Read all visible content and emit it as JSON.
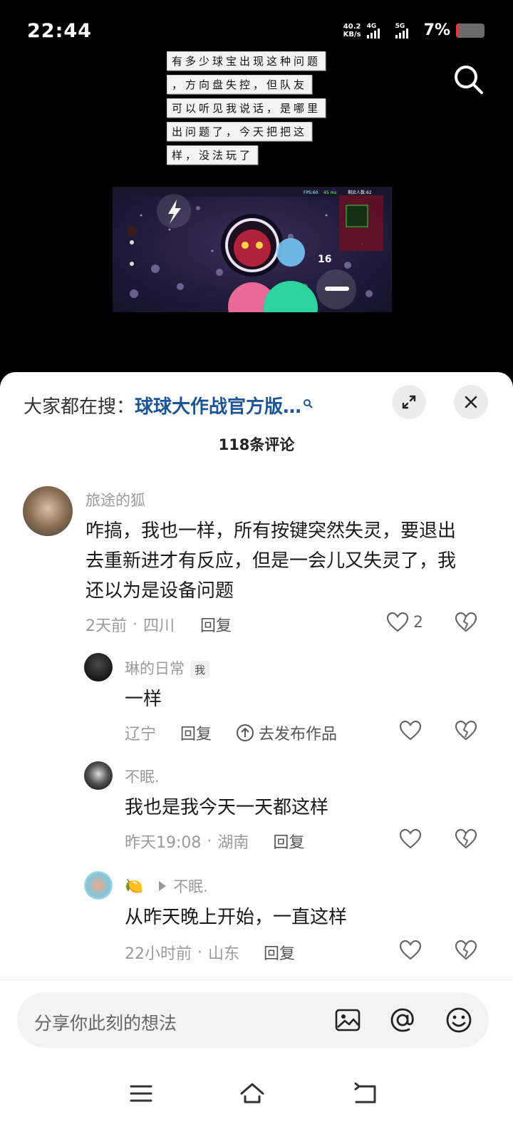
{
  "status_bar": {
    "time": "22:44",
    "net_speed_value": "40.2",
    "net_speed_unit": "KB/s",
    "sim1": "4G",
    "sim2": "5G",
    "battery": "7%"
  },
  "video": {
    "caption_lines": [
      "有多少球宝出现这种问题",
      "，方向盘失控，但队友",
      "可以听见我说话，是哪里",
      "出问题了，今天把把这",
      "样，没法玩了"
    ],
    "game_hud": {
      "fps": "FPS:60",
      "ping": "45 ms",
      "remaining": "剩余人数:62",
      "center_number": "16"
    }
  },
  "sheet": {
    "hot_search_prefix": "大家都在搜：",
    "hot_search_link": "球球大作战官方版…",
    "comment_count": "118条评论"
  },
  "comments": [
    {
      "username": "旅途的狐",
      "text": "咋搞，我也一样，所有按键突然失灵，要退出去重新进才有反应，但是一会儿又失灵了，我还以为是设备问题",
      "time": "2天前",
      "location": "四川",
      "reply": "回复",
      "likes": "2"
    },
    {
      "username": "琳的日常",
      "me_tag": "我",
      "text": "一样",
      "location": "辽宁",
      "reply": "回复",
      "publish": "去发布作品"
    },
    {
      "username": "不眠.",
      "text": "我也是我今天一天都这样",
      "time": "昨天19:08",
      "location": "湖南",
      "reply": "回复"
    },
    {
      "username": "🍋",
      "reply_to": "不眠.",
      "text": "从昨天晚上开始，一直这样",
      "time": "22小时前",
      "location": "山东",
      "reply": "回复"
    }
  ],
  "input": {
    "placeholder": "分享你此刻的想法"
  },
  "colors": {
    "link": "#1e5494",
    "sheet_bg": "#ffffff",
    "battery_low": "#e53935"
  }
}
